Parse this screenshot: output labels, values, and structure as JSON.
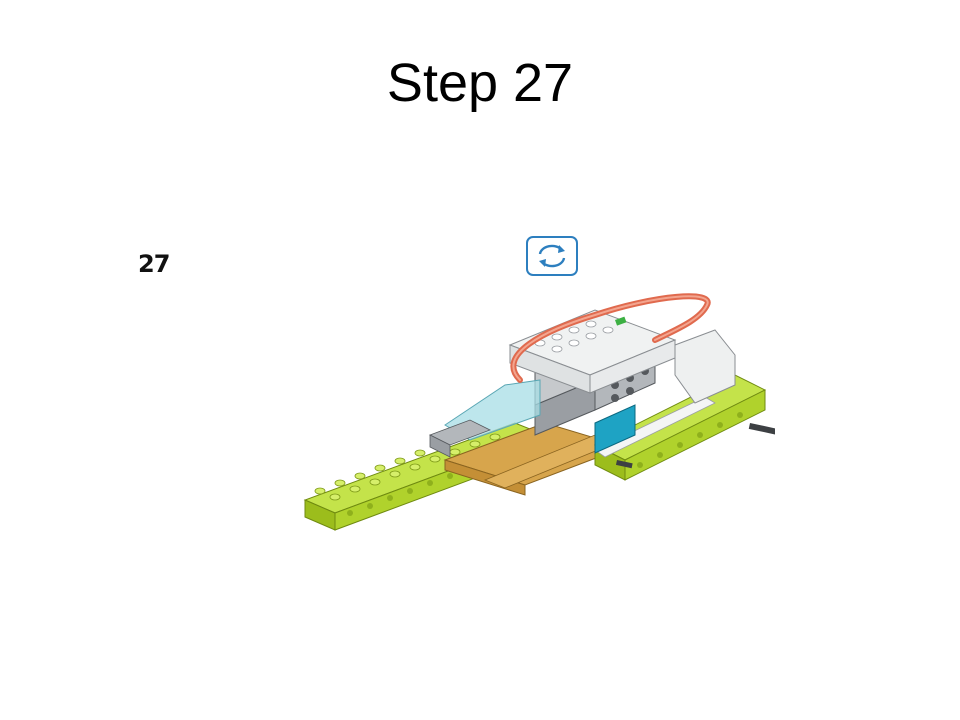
{
  "slide": {
    "title": "Step 27",
    "step_number": "27"
  },
  "icons": {
    "rotate": "rotate-model-icon"
  },
  "colors": {
    "lime": "#b6d730",
    "tan": "#d4a24a",
    "grey": "#9a9ea3",
    "white_brick": "#eef0f0",
    "teal": "#1ea3c4",
    "cable": "#e06a4e",
    "icon_blue": "#2d7fbf"
  }
}
